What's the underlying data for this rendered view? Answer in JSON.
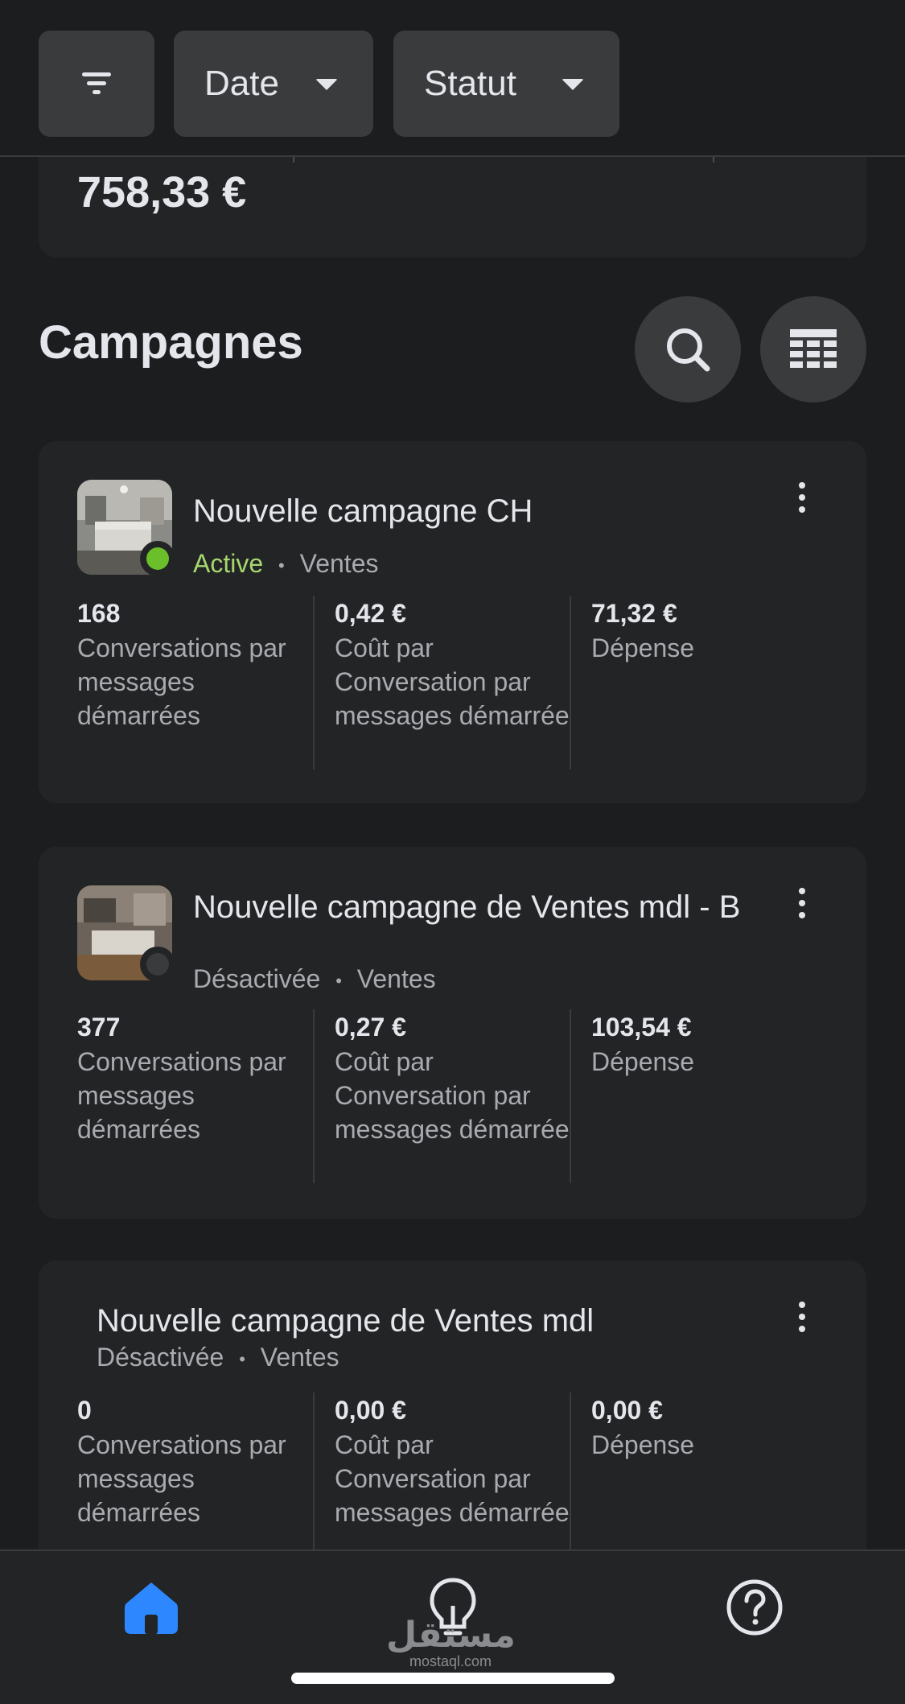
{
  "filters": {
    "date_label": "Date",
    "status_label": "Statut"
  },
  "summary": {
    "value": "758,33 €"
  },
  "section": {
    "title": "Campagnes"
  },
  "campaigns": [
    {
      "title": "Nouvelle campagne CH",
      "status": "Active",
      "status_color": "#6bbf2a",
      "objective": "Ventes",
      "metrics": [
        {
          "value": "168",
          "label": "Conversations par messages démarrées"
        },
        {
          "value": "0,42 €",
          "label": "Coût par Conversation par messages démarrée"
        },
        {
          "value": "71,32 €",
          "label": "Dépense"
        }
      ]
    },
    {
      "title": "Nouvelle campagne de Ventes mdl - B",
      "status": "Désactivée",
      "status_color": "#3a3b3d",
      "objective": "Ventes",
      "metrics": [
        {
          "value": "377",
          "label": "Conversations par messages démarrées"
        },
        {
          "value": "0,27 €",
          "label": "Coût par Conversation par messages démarrée"
        },
        {
          "value": "103,54 €",
          "label": "Dépense"
        }
      ]
    },
    {
      "title": "Nouvelle campagne de Ventes mdl",
      "status": "Désactivée",
      "objective": "Ventes",
      "metrics": [
        {
          "value": "0",
          "label": "Conversations par messages démarrées"
        },
        {
          "value": "0,00 €",
          "label": "Coût par Conversation par messages démarrée"
        },
        {
          "value": "0,00 €",
          "label": "Dépense"
        }
      ]
    }
  ],
  "separator": "•",
  "nav": {
    "items": [
      "home-icon",
      "lightbulb-icon",
      "help-icon"
    ],
    "active_color": "#2d88ff"
  },
  "watermark": {
    "arabic": "مستقل",
    "latin": "mostaql.com"
  }
}
